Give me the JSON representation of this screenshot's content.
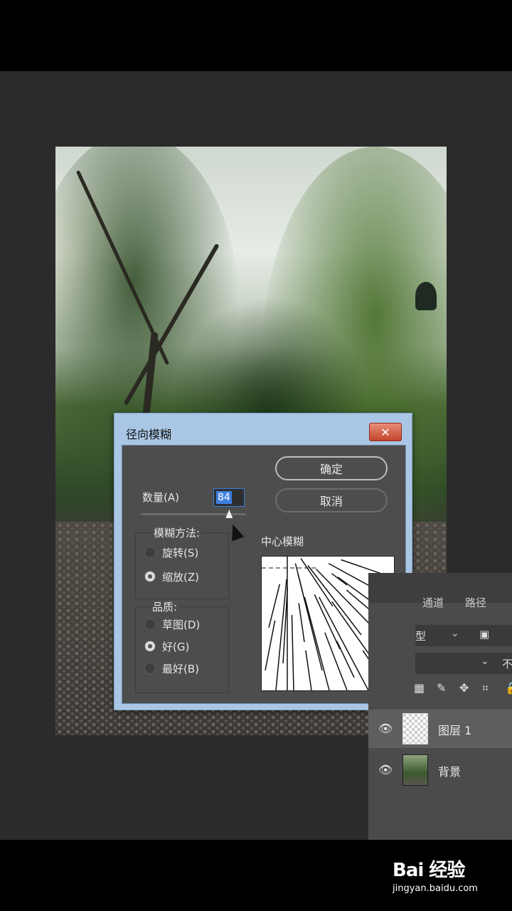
{
  "dialog": {
    "title": "径向模糊",
    "close_label": "✕",
    "amount_label": "数量(A)",
    "amount_value": "84",
    "amount_slider_fraction": 0.84,
    "ok_label": "确定",
    "cancel_label": "取消",
    "method": {
      "legend": "模糊方法:",
      "options": [
        {
          "label": "旋转(S)",
          "selected": false
        },
        {
          "label": "缩放(Z)",
          "selected": true
        }
      ]
    },
    "quality": {
      "legend": "品质:",
      "options": [
        {
          "label": "草图(D)",
          "selected": false
        },
        {
          "label": "好(G)",
          "selected": true
        },
        {
          "label": "最好(B)",
          "selected": false
        }
      ]
    },
    "center_label": "中心模糊"
  },
  "layers_panel": {
    "tabs": [
      "通道",
      "路径"
    ],
    "blend_mode_partial": "型",
    "opacity_partial": "不",
    "layers": [
      {
        "name": "图层 1",
        "visible": true,
        "selected": true
      },
      {
        "name": "背景",
        "visible": true,
        "selected": false
      }
    ]
  },
  "watermark": {
    "title": "Bai 经验",
    "url": "jingyan.baidu.com"
  },
  "icons": {
    "eye": "eye-icon",
    "close": "close-icon",
    "image": "image-icon",
    "brush": "brush-icon",
    "move": "move-icon",
    "crop": "crop-icon",
    "lock": "lock-icon"
  }
}
